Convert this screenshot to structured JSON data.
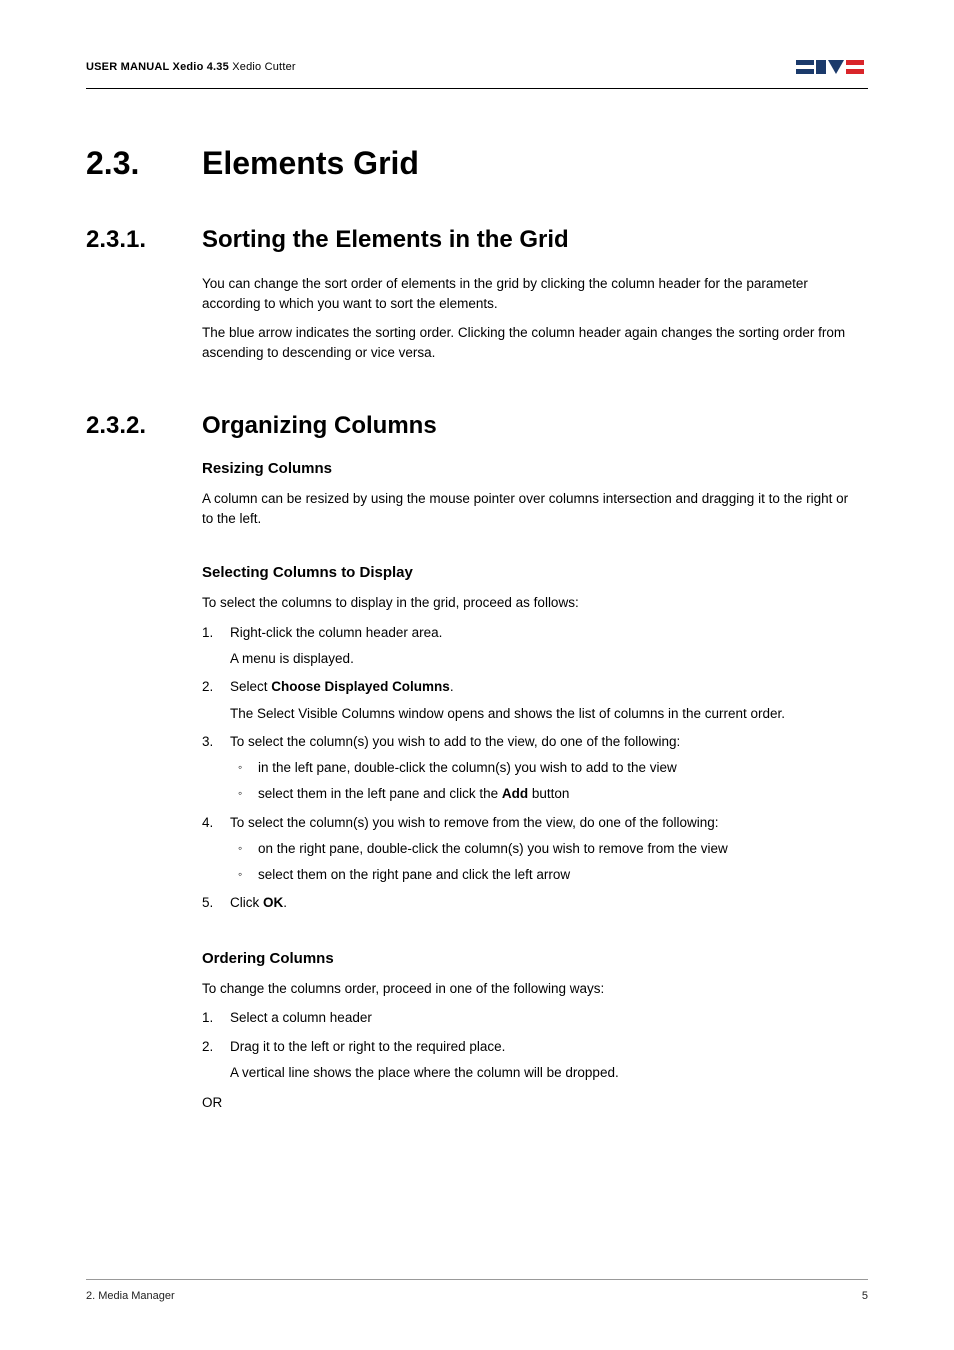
{
  "header": {
    "line_bold": "USER MANUAL Xedio 4.35",
    "line_rest": " Xedio Cutter"
  },
  "h1": {
    "num": "2.3.",
    "title": "Elements Grid"
  },
  "s231": {
    "num": "2.3.1.",
    "title": "Sorting the Elements in the Grid",
    "p1": "You can change the sort order of elements in the grid by clicking the column header for the parameter according to which you want to sort the elements.",
    "p2": "The blue arrow indicates the sorting order. Clicking the column header again changes the sorting order from ascending to descending or vice versa."
  },
  "s232": {
    "num": "2.3.2.",
    "title": "Organizing Columns",
    "resizing": {
      "title": "Resizing Columns",
      "p": "A column can be resized by using the mouse pointer over columns intersection and dragging it to the right or to the left."
    },
    "selecting": {
      "title": "Selecting Columns to Display",
      "intro": "To select the columns to display in the grid, proceed as follows:",
      "li1": "Right-click the column header area.",
      "li1_sub": "A menu is displayed.",
      "li2_a": "Select ",
      "li2_b": "Choose Displayed Columns",
      "li2_c": ".",
      "li2_sub": "The Select Visible Columns window opens and shows the list of columns in the current order.",
      "li3": "To select the column(s) you wish to add to the view, do one of the following:",
      "li3_b1": "in the left pane, double-click the column(s) you wish to add to the view",
      "li3_b2a": "select them in the left pane and click the ",
      "li3_b2b": "Add",
      "li3_b2c": " button",
      "li4": "To select the column(s) you wish to remove from the view, do one of the following:",
      "li4_b1": "on the right pane, double-click the column(s) you wish to remove from the view",
      "li4_b2": "select them on the right pane and click the left arrow",
      "li5_a": "Click ",
      "li5_b": "OK",
      "li5_c": "."
    },
    "ordering": {
      "title": "Ordering Columns",
      "intro": "To change the columns order, proceed in one of the following ways:",
      "li1": "Select a column header",
      "li2": "Drag it to the left or right to the required place.",
      "li2_sub": "A vertical line shows the place where the column will be dropped.",
      "or": "OR"
    }
  },
  "footer": {
    "left": "2. Media Manager",
    "right": "5"
  }
}
